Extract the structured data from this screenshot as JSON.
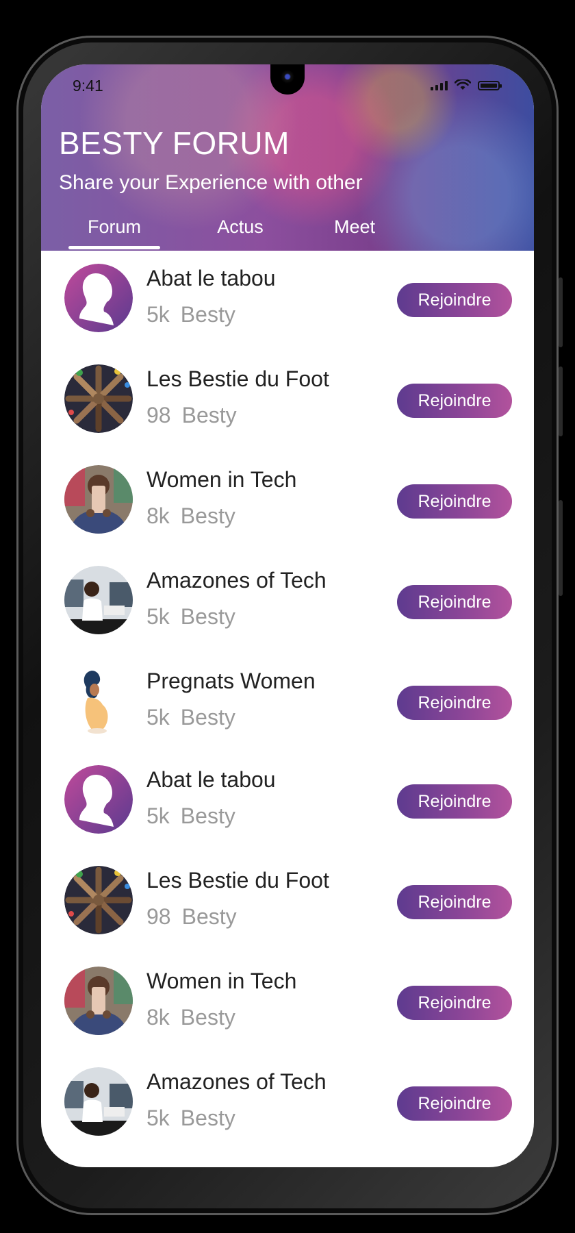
{
  "status_bar": {
    "time": "9:41"
  },
  "header": {
    "title": "BESTY FORUM",
    "subtitle": "Share your Experience with other"
  },
  "tabs": [
    {
      "label": "Forum",
      "active": true
    },
    {
      "label": "Actus",
      "active": false
    },
    {
      "label": "Meet",
      "active": false
    }
  ],
  "groups": [
    {
      "name": "Abat le tabou",
      "count": "5k",
      "unit": "Besty",
      "avatar": "woman-silhouette-icon",
      "button": "Rejoindre"
    },
    {
      "name": "Les Bestie du Foot",
      "count": "98",
      "unit": "Besty",
      "avatar": "hands-circle-photo",
      "button": "Rejoindre"
    },
    {
      "name": "Women in Tech",
      "count": "8k",
      "unit": "Besty",
      "avatar": "woman-phone-photo",
      "button": "Rejoindre"
    },
    {
      "name": "Amazones of Tech",
      "count": "5k",
      "unit": "Besty",
      "avatar": "woman-lab-photo",
      "button": "Rejoindre"
    },
    {
      "name": "Pregnats Women",
      "count": "5k",
      "unit": "Besty",
      "avatar": "pregnant-woman-illustration",
      "button": "Rejoindre"
    },
    {
      "name": "Abat le tabou",
      "count": "5k",
      "unit": "Besty",
      "avatar": "woman-silhouette-icon",
      "button": "Rejoindre"
    },
    {
      "name": "Les Bestie du Foot",
      "count": "98",
      "unit": "Besty",
      "avatar": "hands-circle-photo",
      "button": "Rejoindre"
    },
    {
      "name": "Women in Tech",
      "count": "8k",
      "unit": "Besty",
      "avatar": "woman-phone-photo",
      "button": "Rejoindre"
    },
    {
      "name": "Amazones of Tech",
      "count": "5k",
      "unit": "Besty",
      "avatar": "woman-lab-photo",
      "button": "Rejoindre"
    }
  ],
  "colors": {
    "accent_start": "#5e3b8f",
    "accent_end": "#b2529c",
    "title_text": "#222222",
    "sub_text": "#999999"
  }
}
